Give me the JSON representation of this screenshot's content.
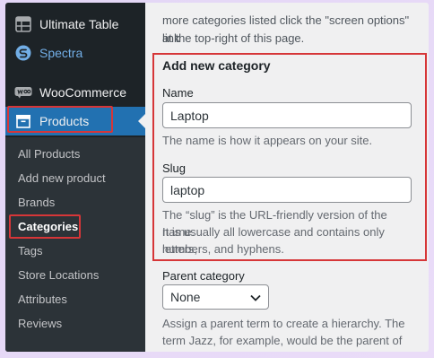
{
  "sidebar": {
    "items": [
      {
        "label": "Ultimate Table",
        "icon": "table-icon"
      },
      {
        "label": "Spectra",
        "icon": "spectra-icon"
      },
      {
        "label": "WooCommerce",
        "icon": "woocommerce-icon"
      },
      {
        "label": "Products",
        "icon": "products-icon"
      }
    ],
    "submenu": [
      "All Products",
      "Add new product",
      "Brands",
      "Categories",
      "Tags",
      "Store Locations",
      "Attributes",
      "Reviews"
    ]
  },
  "main": {
    "intro_line1": "more categories listed click the \"screen options\" link",
    "intro_line2": "at the top-right of this page.",
    "heading": "Add new category",
    "name_label": "Name",
    "name_value": "Laptop",
    "name_desc": "The name is how it appears on your site.",
    "slug_label": "Slug",
    "slug_value": "laptop",
    "slug_desc_1": "The “slug” is the URL-friendly version of the name.",
    "slug_desc_2": "It is usually all lowercase and contains only letters,",
    "slug_desc_3": "numbers, and hyphens.",
    "parent_label": "Parent category",
    "parent_value": "None",
    "parent_desc_1": "Assign a parent term to create a hierarchy. The",
    "parent_desc_2": "term Jazz, for example, would be the parent of"
  },
  "colors": {
    "sidebar_bg": "#1d2327",
    "submenu_bg": "#2c3338",
    "active_bg": "#2271b1",
    "highlight_red": "#d63638",
    "spectra_blue": "#72aee6"
  }
}
